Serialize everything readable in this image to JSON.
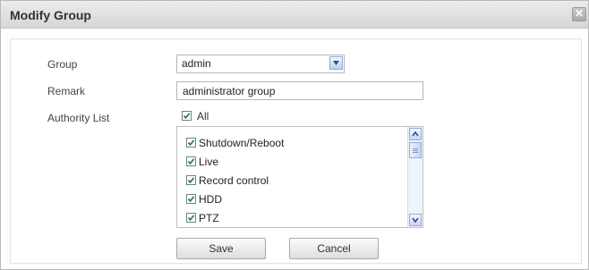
{
  "dialog": {
    "title": "Modify Group",
    "close_glyph": "✕"
  },
  "form": {
    "group_label": "Group",
    "group_value": "admin",
    "remark_label": "Remark",
    "remark_value": "administrator group",
    "authority_label": "Authority List",
    "all_label": "All",
    "all_checked": true
  },
  "authority_items": [
    {
      "label": "Shutdown/Reboot",
      "checked": true
    },
    {
      "label": "Live",
      "checked": true
    },
    {
      "label": "Record control",
      "checked": true
    },
    {
      "label": "HDD",
      "checked": true
    },
    {
      "label": "PTZ",
      "checked": true
    }
  ],
  "buttons": {
    "save": "Save",
    "cancel": "Cancel"
  },
  "colors": {
    "check": "#2d8a2d",
    "scroll_accent": "#95acd7"
  },
  "icons": {
    "close": "close-icon",
    "dropdown": "chevron-down-icon",
    "checkbox": "checkmark-icon",
    "scroll_up": "arrow-up-icon",
    "scroll_down": "arrow-down-icon"
  }
}
